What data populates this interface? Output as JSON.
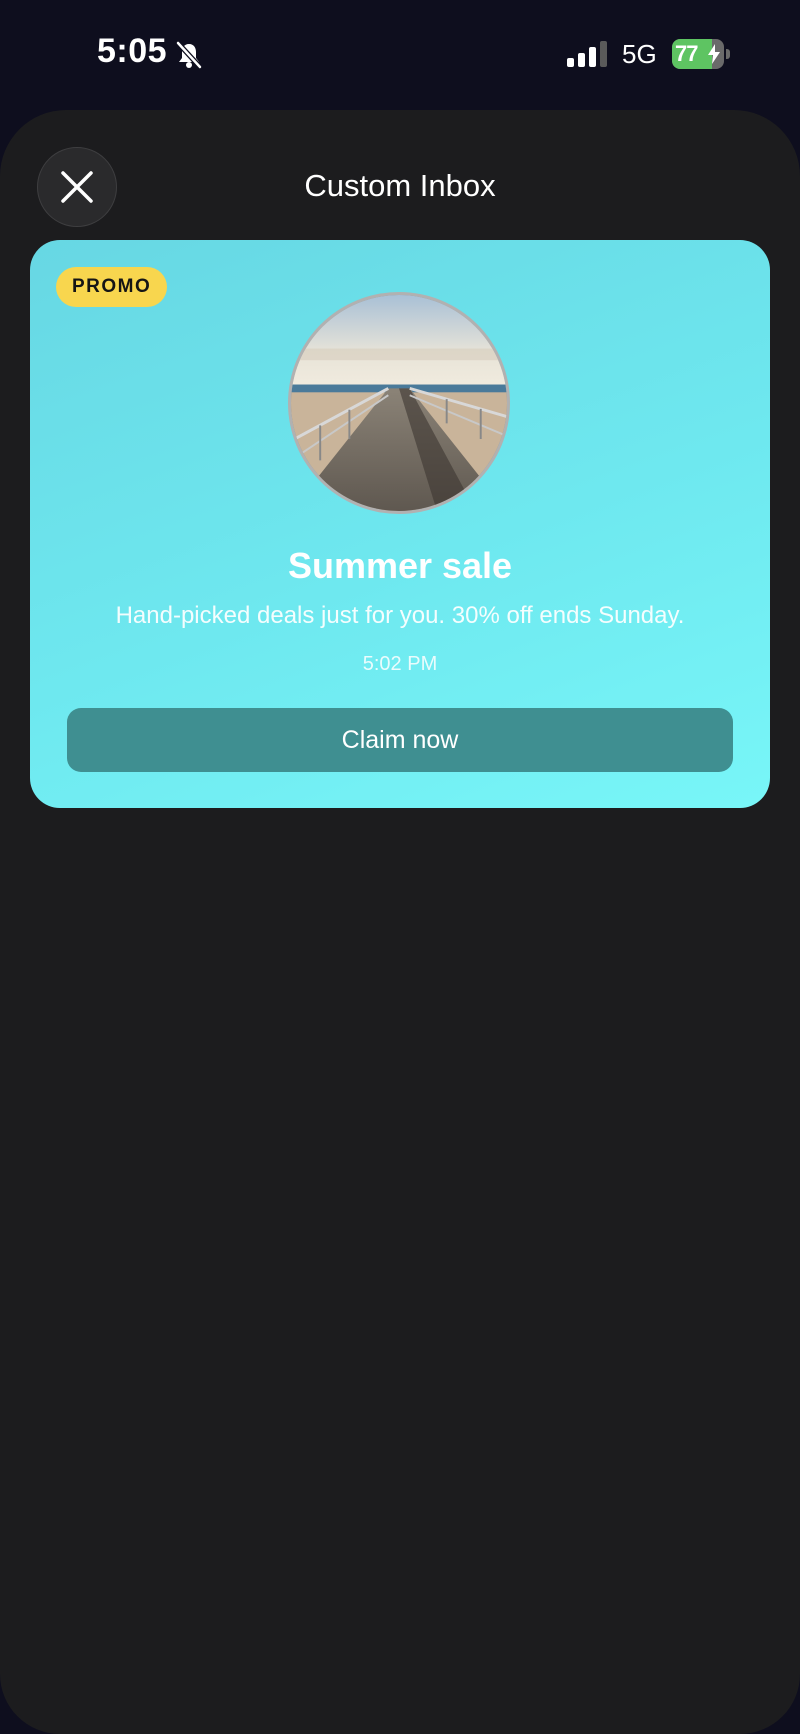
{
  "status_bar": {
    "time": "5:05",
    "network": "5G",
    "battery_percent": "77",
    "battery_level": 0.77,
    "icons": [
      "bell-slash-icon",
      "signal-icon",
      "battery-charging-icon"
    ]
  },
  "sheet": {
    "title": "Custom Inbox",
    "close_icon": "close-icon"
  },
  "promo_card": {
    "badge": "PROMO",
    "title": "Summer sale",
    "body": "Hand-picked deals just for you. 30% off ends Sunday.",
    "time": "5:02 PM",
    "button_label": "Claim now",
    "image": "boardwalk-pier-photo",
    "colors": {
      "card_gradient_start": "#67d7e3",
      "card_gradient_end": "#78f6f8",
      "badge": "#f8d64e",
      "button": "#3f8f91"
    }
  }
}
